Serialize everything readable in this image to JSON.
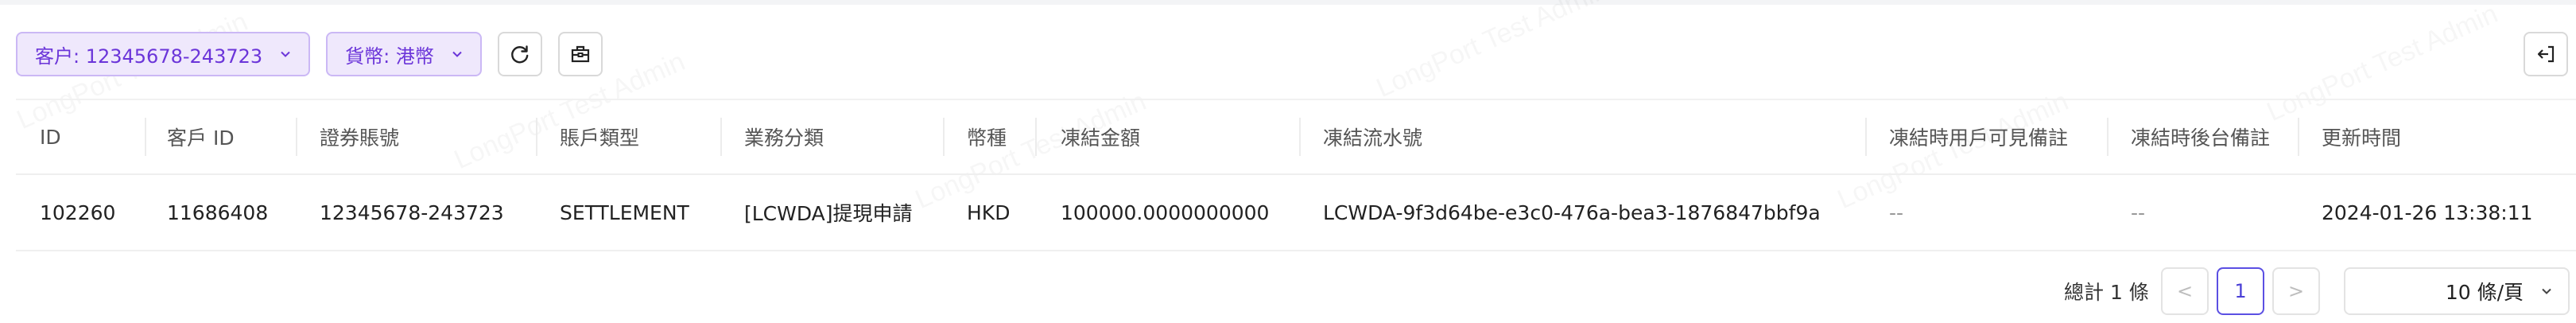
{
  "watermark": "LongPort Test Admin",
  "filters": {
    "customer_label": "客户: 12345678-243723",
    "currency_label": "貨幣: 港幣"
  },
  "icons": {
    "chevron": "chevron-down-icon",
    "refresh": "refresh-icon",
    "export": "export-box-icon",
    "exit": "exit-icon"
  },
  "table": {
    "columns": [
      "ID",
      "客戶 ID",
      "證券賬號",
      "賬戶類型",
      "業務分類",
      "幣種",
      "凍結金額",
      "凍結流水號",
      "凍結時用戶可見備註",
      "凍結時後台備註",
      "更新時間"
    ],
    "rows": [
      [
        "102260",
        "11686408",
        "12345678-243723",
        "SETTLEMENT",
        "[LCWDA]提現申請",
        "HKD",
        "100000.0000000000",
        "LCWDA-9f3d64be-e3c0-476a-bea3-1876847bbf9a",
        "--",
        "--",
        "2024-01-26 13:38:11"
      ]
    ]
  },
  "pagination": {
    "total_text": "總計 1 條",
    "prev": "<",
    "current_page": "1",
    "next": ">",
    "page_size_label": "10 條/頁"
  },
  "colors": {
    "accent": "#6b35d9",
    "chip_bg": "#efe8fc",
    "page_active": "#4a3fd6"
  }
}
